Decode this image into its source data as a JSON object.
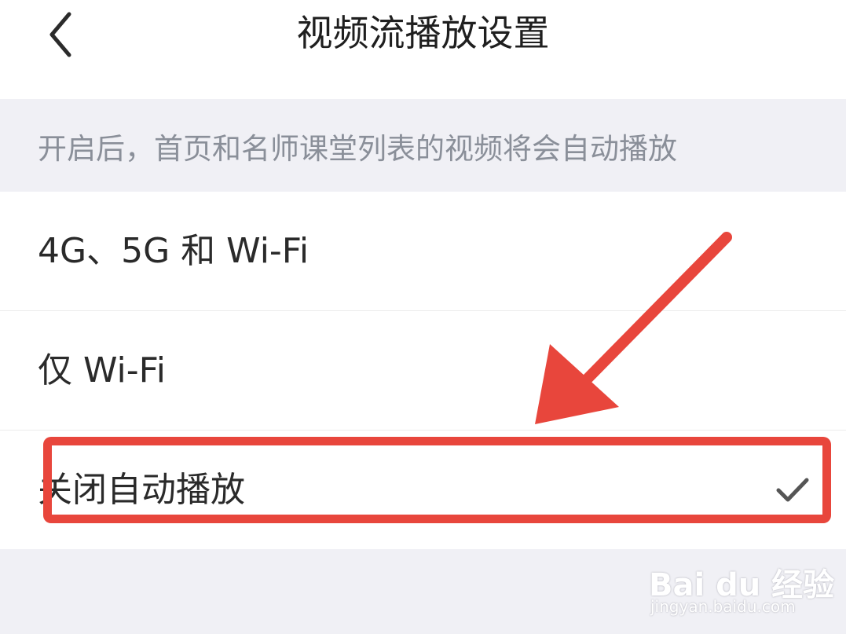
{
  "header": {
    "back_icon": "chevron-left-icon",
    "title": "视频流播放设置"
  },
  "description": "开启后，首页和名师课堂列表的视频将会自动播放",
  "options": [
    {
      "label": "4G、5G 和 Wi-Fi",
      "selected": false
    },
    {
      "label": "仅 Wi-Fi",
      "selected": false
    },
    {
      "label": "关闭自动播放",
      "selected": true
    }
  ],
  "check_icon": "checkmark-icon",
  "annotation_color": "#e8463c",
  "watermark": {
    "main": "Bai du 经验",
    "sub": "jingyan.baidu.com"
  }
}
